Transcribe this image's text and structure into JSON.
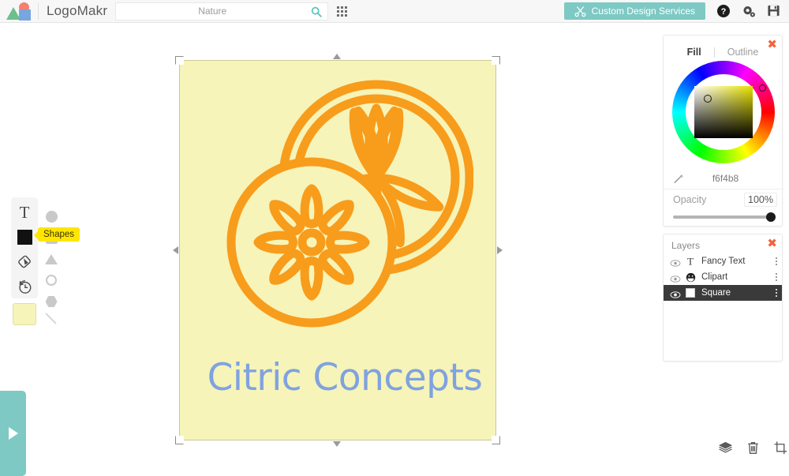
{
  "header": {
    "brand_name": "LogoMakr",
    "brand_icons": [
      "triangle-green",
      "circle-salmon",
      "square-blue"
    ],
    "search": {
      "value": "",
      "placeholder": "Nature",
      "icon": "search-icon"
    },
    "grid_icon": "grid-apps-icon",
    "custom_design_label": "Custom Design Services",
    "custom_design_icon": "scissors-icon",
    "right_icons": [
      "help-icon",
      "settings-gear-icon",
      "save-disk-icon"
    ],
    "accent_teal": "#7ec9c4"
  },
  "toolbar": {
    "tools": [
      {
        "name": "text-tool",
        "glyph": "T"
      },
      {
        "name": "shapes-tool",
        "glyph": "square"
      },
      {
        "name": "paint-bucket-tool",
        "glyph": "bucket"
      },
      {
        "name": "history-tool",
        "glyph": "clock-back"
      }
    ],
    "tooltip": "Shapes",
    "swatch_color": "#f6f4b8",
    "subtools": [
      "circle-filled",
      "square-filled",
      "triangle",
      "circle-outline",
      "hexagon",
      "line"
    ]
  },
  "flyout": {
    "name": "expand-panel-tab",
    "icon": "play-triangle"
  },
  "canvas": {
    "artboard_color": "#f6f4b8",
    "clipart_color": "#f89c1c",
    "clipart_name": "citrus-slices",
    "logo_text": "Citric Concepts",
    "logo_text_color": "#7fa2e0",
    "selection": {
      "handles": [
        "corner-tl",
        "corner-tr",
        "corner-bl",
        "corner-br",
        "edge-top",
        "edge-bottom",
        "edge-left",
        "edge-right"
      ]
    }
  },
  "color_panel": {
    "tab_fill": "Fill",
    "tab_outline": "Outline",
    "active_tab": "Fill",
    "hex_value": "f6f4b8",
    "dropper_icon": "eyedropper-icon",
    "opacity_label": "Opacity",
    "opacity_value": "100%",
    "close_icon": "close-icon"
  },
  "layers_panel": {
    "title": "Layers",
    "close_icon": "close-icon",
    "rows": [
      {
        "name": "Fancy Text",
        "icon": "text-T-icon",
        "visible": true,
        "selected": false
      },
      {
        "name": "Clipart",
        "icon": "smiley-icon",
        "visible": true,
        "selected": false
      },
      {
        "name": "Square",
        "icon": "square-swatch-icon",
        "visible": true,
        "selected": true
      }
    ]
  },
  "bottom_bar": {
    "icons": [
      "layers-stack-icon",
      "trash-icon",
      "crop-icon"
    ]
  }
}
